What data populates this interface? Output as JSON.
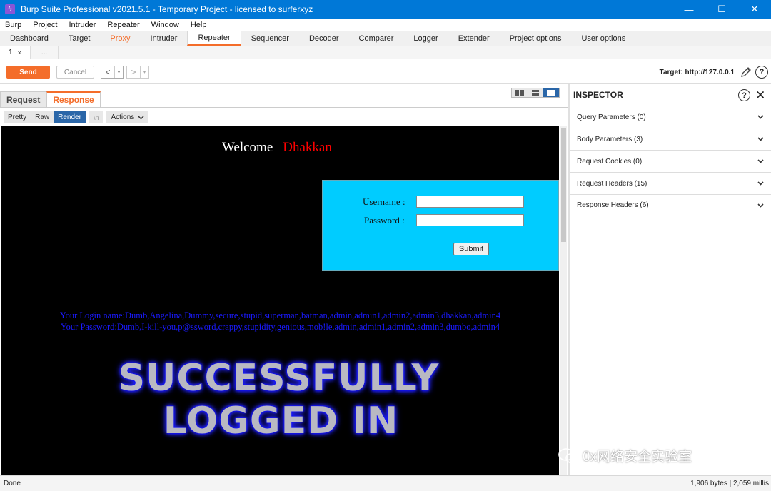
{
  "window": {
    "title": "Burp Suite Professional v2021.5.1 - Temporary Project - licensed to surferxyz",
    "controls": [
      "—",
      "☐",
      "✕"
    ]
  },
  "menu": [
    "Burp",
    "Project",
    "Intruder",
    "Repeater",
    "Window",
    "Help"
  ],
  "main_tabs": [
    "Dashboard",
    "Target",
    "Proxy",
    "Intruder",
    "Repeater",
    "Sequencer",
    "Decoder",
    "Comparer",
    "Logger",
    "Extender",
    "Project options",
    "User options"
  ],
  "active_main_tab": "Repeater",
  "sub_tabs": {
    "tab1": "1",
    "close": "×",
    "more": "..."
  },
  "toolbar": {
    "send": "Send",
    "cancel": "Cancel",
    "prev": "<",
    "next": ">",
    "dropdown": "▾",
    "target": "Target: http://127.0.0.1"
  },
  "editor": {
    "tabs": {
      "request": "Request",
      "response": "Response"
    },
    "format": {
      "pretty": "Pretty",
      "raw": "Raw",
      "render": "Render",
      "newline": "\\n",
      "actions": "Actions"
    }
  },
  "rendered_page": {
    "welcome": "Welcome",
    "user": "Dhakkan",
    "username_label": "Username :",
    "password_label": "Password :",
    "submit": "Submit",
    "login_names": "Your Login name:Dumb,Angelina,Dummy,secure,stupid,superman,batman,admin,admin1,admin2,admin3,dhakkan,admin4",
    "passwords": "Your Password:Dumb,I-kill-you,p@ssword,crappy,stupidity,genious,mob!le,admin,admin1,admin2,admin3,dumbo,admin4",
    "success_line1": "SUCCESSFULLY",
    "success_line2": "LOGGED IN"
  },
  "inspector": {
    "title": "INSPECTOR",
    "sections": [
      "Query Parameters (0)",
      "Body Parameters (3)",
      "Request Cookies (0)",
      "Request Headers (15)",
      "Response Headers (6)"
    ]
  },
  "status": {
    "left": "Done",
    "right": "1,906 bytes | 2,059 millis"
  },
  "watermark": "0x网络安全实验室",
  "colors": {
    "accent": "#f46d2a",
    "titlebar": "#0078d7",
    "login_box": "#00ccff",
    "selected": "#2a66a8"
  }
}
